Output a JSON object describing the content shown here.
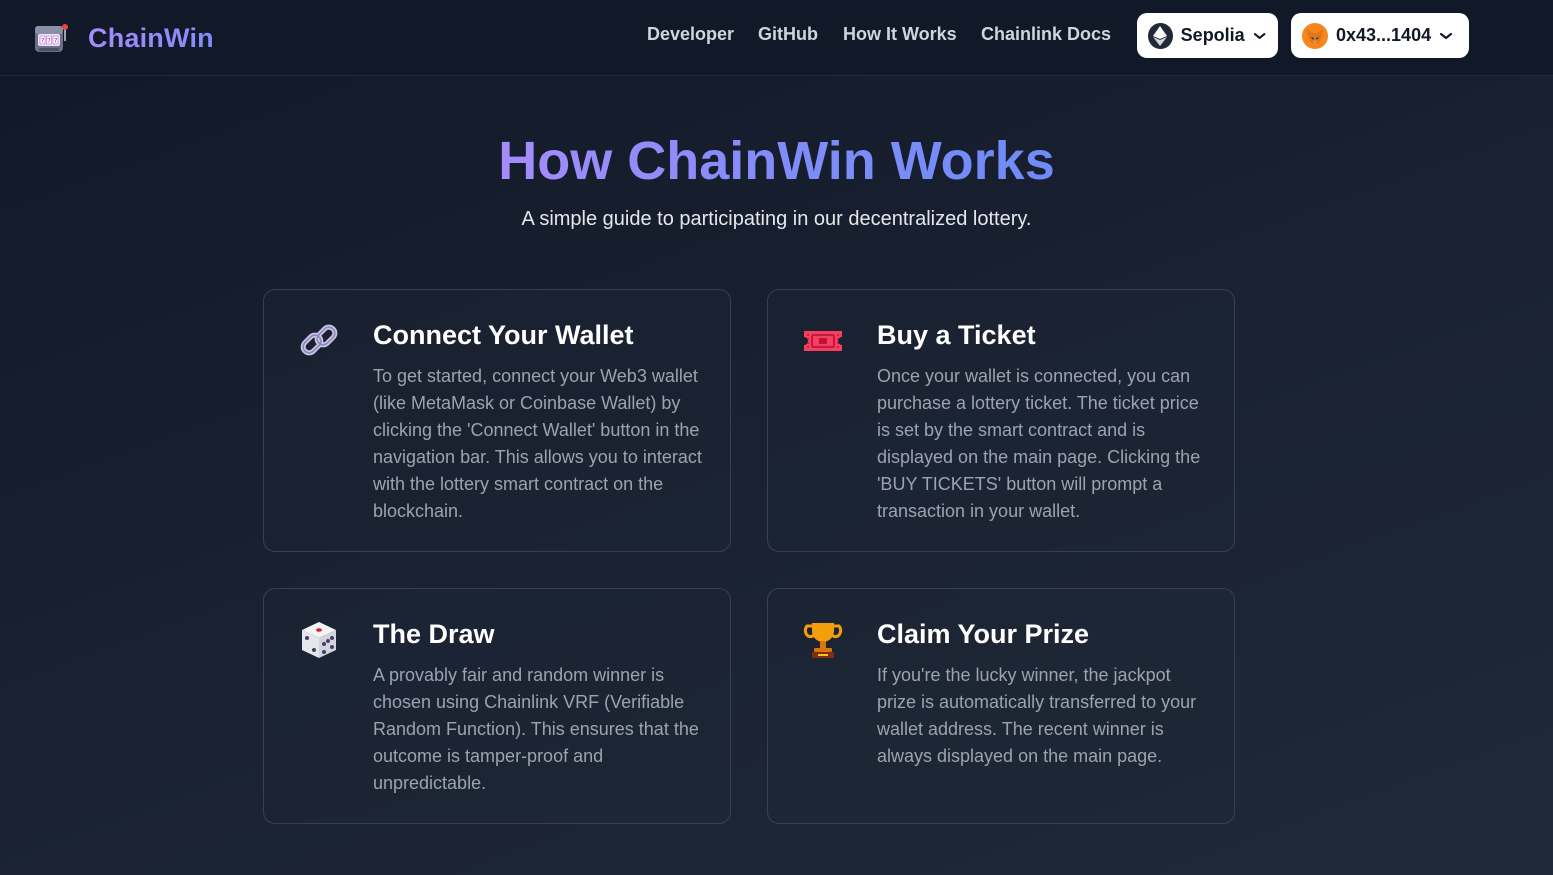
{
  "brand": {
    "name": "ChainWin",
    "icon": "slot-machine-icon"
  },
  "nav": {
    "links": [
      {
        "label": "Developer"
      },
      {
        "label": "GitHub"
      },
      {
        "label": "How It Works"
      },
      {
        "label": "Chainlink Docs"
      }
    ],
    "network": {
      "label": "Sepolia",
      "icon": "ethereum-icon"
    },
    "account": {
      "label": "0x43...1404",
      "icon": "metamask-fox-icon"
    }
  },
  "hero": {
    "title": "How ChainWin Works",
    "subtitle": "A simple guide to participating in our decentralized lottery."
  },
  "steps": [
    {
      "icon": "link-icon",
      "title": "Connect Your Wallet",
      "text": "To get started, connect your Web3 wallet (like MetaMask or Coinbase Wallet) by clicking the 'Connect Wallet' button in the navigation bar. This allows you to interact with the lottery smart contract on the blockchain."
    },
    {
      "icon": "ticket-icon",
      "title": "Buy a Ticket",
      "text": "Once your wallet is connected, you can purchase a lottery ticket. The ticket price is set by the smart contract and is displayed on the main page. Clicking the 'BUY TICKETS' button will prompt a transaction in your wallet."
    },
    {
      "icon": "dice-icon",
      "title": "The Draw",
      "text": "A provably fair and random winner is chosen using Chainlink VRF (Verifiable Random Function). This ensures that the outcome is tamper-proof and unpredictable."
    },
    {
      "icon": "trophy-icon",
      "title": "Claim Your Prize",
      "text": "If you're the lucky winner, the jackpot prize is automatically transferred to your wallet address. The recent winner is always displayed on the main page."
    }
  ],
  "colors": {
    "accent_start": "#a78bfa",
    "accent_end": "#818cf8",
    "background": "#111827",
    "card_border": "#374151"
  }
}
